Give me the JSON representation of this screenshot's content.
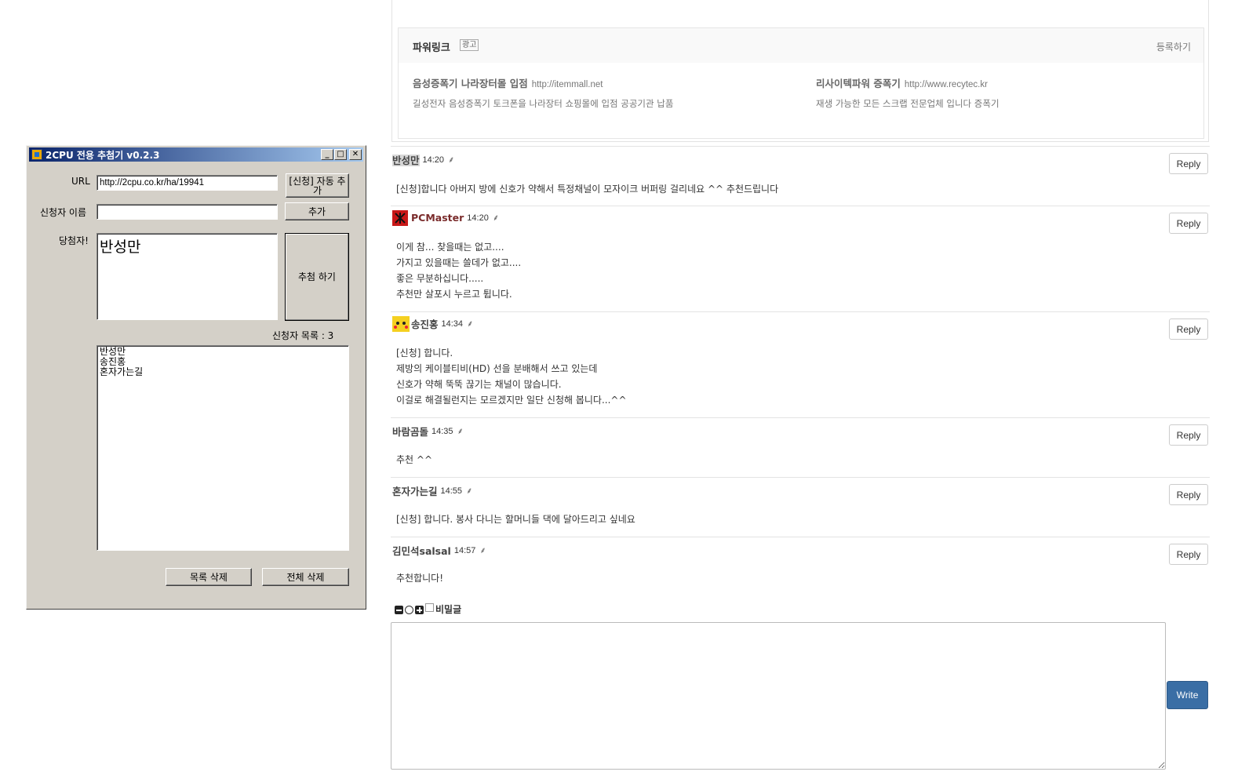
{
  "powerlink": {
    "title": "파워링크",
    "ad_badge": "광고",
    "register": "등록하기",
    "ads": [
      {
        "title": "음성증폭기 나라장터몰 입점",
        "url": "http://itemmall.net",
        "desc": "길성전자 음성증폭기 토크폰을 나라장터 쇼핑몰에 입점 공공기관 납품"
      },
      {
        "title": "리사이텍파워 증폭기",
        "url": "http://www.recytec.kr",
        "desc": "재생 가능한 모든 스크랩 전문업체 입니다 증폭기"
      }
    ]
  },
  "comments": [
    {
      "name": "반성만",
      "time": "14:20",
      "lines": [
        "[신청]합니다 아버지 방에 신호가 약해서 특정채널이 모자이크 버퍼링 걸리네요 ^^ 추천드립니다"
      ]
    },
    {
      "name": "PCMaster",
      "time": "14:20",
      "lines": [
        "이게 참... 찾을때는 없고....",
        "가지고 있을때는 쓸데가 없고....",
        "좋은 무분하십니다.....",
        "추천만 살포시 누르고 튑니다."
      ]
    },
    {
      "name": "송진홍",
      "time": "14:34",
      "lines": [
        "[신청] 합니다.",
        "제방의 케이블티비(HD) 선을 분배해서 쓰고 있는데",
        "신호가 약해 뚝뚝 끊기는 채널이 많습니다.",
        "이걸로 해결될런지는 모르겠지만 일단 신청해 봅니다...^^"
      ]
    },
    {
      "name": "바람곰돌",
      "time": "14:35",
      "lines": [
        "추천 ^^"
      ]
    },
    {
      "name": "혼자가는길",
      "time": "14:55",
      "lines": [
        "[신청] 합니다. 봉사 다니는 할머니들 댁에 달아드리고 싶네요"
      ]
    },
    {
      "name": "김민석salsal",
      "time": "14:57",
      "lines": [
        "추천합니다!"
      ]
    }
  ],
  "reply_label": "Reply",
  "leaf_symbol": "⸙",
  "form": {
    "secret_label": "비밀글",
    "comment_value": "",
    "write_label": "Write"
  },
  "app": {
    "title": "2CPU 전용 추첨기 v0.2.3",
    "url_label": "URL",
    "url_value": "http://2cpu.co.kr/ha/19941",
    "auto_add_label": "[신청] 자동 추가",
    "name_label": "신청자 이름",
    "name_value": "",
    "add_label": "추가",
    "winner_label": "당첨자!",
    "winner_value": "반성만",
    "draw_label": "추첨 하기",
    "list_count_label": "신청자 목록 : 3",
    "applicants": [
      "반성만",
      "송진홍",
      "혼자가는길"
    ],
    "delete_item_label": "목록 삭제",
    "delete_all_label": "전체 삭제"
  },
  "colors": {
    "write_button": "#3a6ea5",
    "titlebar_start": "#0a246a",
    "titlebar_end": "#a6caf0",
    "window_face": "#d4d0c8"
  }
}
